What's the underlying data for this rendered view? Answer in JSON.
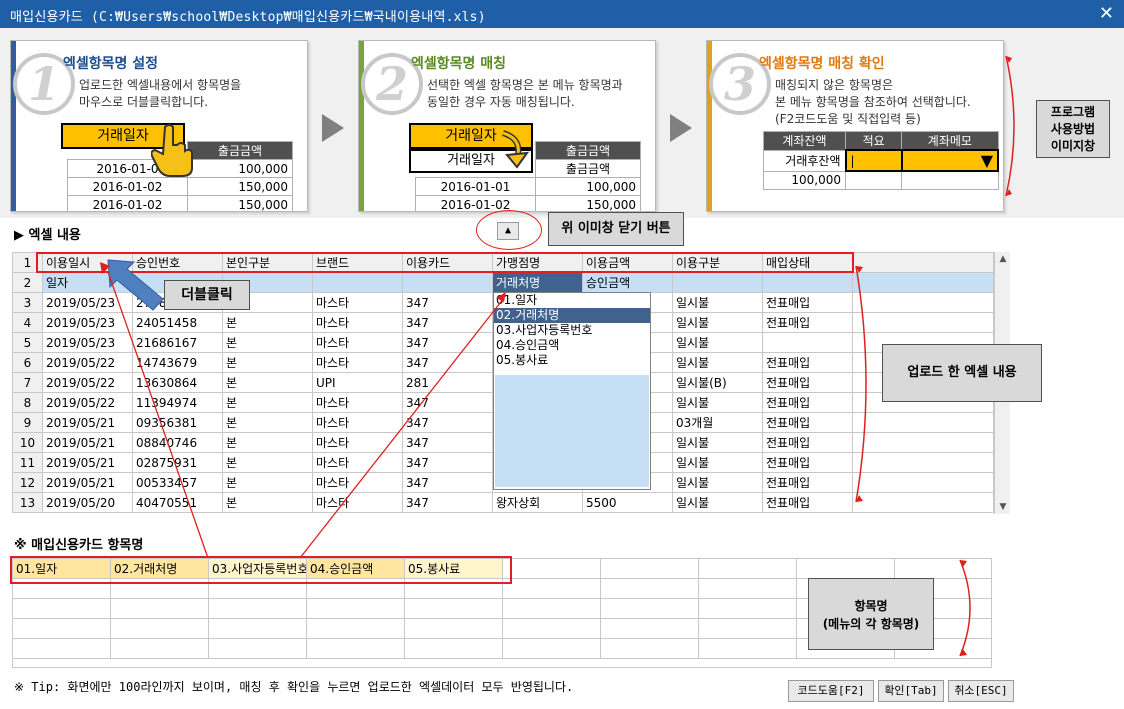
{
  "window": {
    "title": "매입신용카드 (C:₩Users₩school₩Desktop₩매입신용카드₩국내이용내역.xls)",
    "close_glyph": "✕"
  },
  "guide": {
    "step1": {
      "num": "1",
      "title": "엑셀항목명 설정",
      "desc1": "업로드한 엑셀내용에서 항목명을",
      "desc2": "마우스로 더블클릭합니다.",
      "highlight": "거래일자",
      "col2_header": "출금금액",
      "rows": [
        [
          "2016-01-0",
          "100,000"
        ],
        [
          "2016-01-02",
          "150,000"
        ],
        [
          "2016-01-02",
          "150,000"
        ]
      ]
    },
    "step2": {
      "num": "2",
      "title": "엑셀항목명 매칭",
      "desc1": "선택한 엑셀 항목명은 본 메뉴 항목명과",
      "desc2": "동일한 경우 자동 매칭됩니다.",
      "highlight": "거래일자",
      "match": "거래일자",
      "col2_header": "출금금액",
      "col2_sub": "출금금액",
      "rows": [
        [
          "2016-01-01",
          "100,000"
        ],
        [
          "2016-01-02",
          "150,000"
        ]
      ]
    },
    "step3": {
      "num": "3",
      "title": "엑셀항목명 매칭 확인",
      "desc1": "매칭되지 않은 항목명은",
      "desc2": "본 메뉴 항목명을 참조하여 선택합니다.",
      "desc3": "(F2코드도움 및 직접입력 등)",
      "headers": [
        "계좌잔액",
        "적요",
        "계좌메모"
      ],
      "row1": [
        "거래후잔액",
        "|",
        "▼"
      ],
      "row2": [
        "100,000",
        "",
        ""
      ]
    },
    "program_label": [
      "프로그램",
      "사용방법",
      "이미지창"
    ]
  },
  "excel": {
    "title": "▶ 엑셀 내용",
    "close_btn": "▲",
    "close_callout": "위 이미창 닫기 버튼",
    "dblclick_callout": "더블클릭",
    "uploaded_callout": "업로드 한 엑셀 내용",
    "headers": [
      "이용일시",
      "승인번호",
      "본인구분",
      "브랜드",
      "이용카드",
      "가맹점명",
      "이용금액",
      "이용구분",
      "매입상태"
    ],
    "row2": [
      "일자",
      "",
      "",
      "",
      "",
      "거래처명",
      "승인금액",
      "",
      ""
    ],
    "rows": [
      [
        "3",
        "2019/05/23",
        "27781",
        "본",
        "마스타",
        "347",
        "",
        "",
        "일시불",
        "전표매입"
      ],
      [
        "4",
        "2019/05/23",
        "24051458",
        "본",
        "마스타",
        "347",
        "",
        "",
        "일시불",
        "전표매입"
      ],
      [
        "5",
        "2019/05/23",
        "21686167",
        "본",
        "마스타",
        "347",
        "",
        "",
        "일시불",
        ""
      ],
      [
        "6",
        "2019/05/22",
        "14743679",
        "본",
        "마스타",
        "347",
        "",
        "",
        "일시불",
        "전표매입"
      ],
      [
        "7",
        "2019/05/22",
        "13630864",
        "본",
        "UPI",
        "281",
        "",
        "",
        "일시불(B)",
        "전표매입"
      ],
      [
        "8",
        "2019/05/22",
        "11394974",
        "본",
        "마스타",
        "347",
        "",
        "",
        "일시불",
        "전표매입"
      ],
      [
        "9",
        "2019/05/21",
        "09356381",
        "본",
        "마스타",
        "347",
        "",
        "",
        "03개월",
        "전표매입"
      ],
      [
        "10",
        "2019/05/21",
        "08840746",
        "본",
        "마스타",
        "347",
        "",
        "",
        "일시불",
        "전표매입"
      ],
      [
        "11",
        "2019/05/21",
        "02875931",
        "본",
        "마스타",
        "347",
        "",
        "",
        "일시불",
        "전표매입"
      ],
      [
        "12",
        "2019/05/21",
        "00533457",
        "본",
        "마스타",
        "347",
        "",
        "",
        "일시불",
        "전표매입"
      ],
      [
        "13",
        "2019/05/20",
        "40470551",
        "본",
        "마스타",
        "347",
        "왕자상회",
        "5500",
        "일시불",
        "전표매입"
      ]
    ],
    "dropdown": [
      "01.일자",
      "02.거래처명",
      "03.사업자등록번호",
      "04.승인금액",
      "05.봉사료"
    ]
  },
  "items": {
    "title": "※ 매입신용카드 항목명",
    "cells": [
      "01.일자",
      "02.거래처명",
      "03.사업자등록번호",
      "04.승인금액",
      "05.봉사료"
    ],
    "callout1": "항목명",
    "callout2": "(메뉴의 각 항목명)"
  },
  "footer": {
    "tip": "※ Tip: 화면에만 100라인까지 보이며, 매칭 후 확인을 누르면 업로드한 엑셀데이터 모두 반영됩니다.",
    "btn_code": "코드도움[F2]",
    "btn_ok": "확인[Tab]",
    "btn_cancel": "취소[ESC]"
  }
}
